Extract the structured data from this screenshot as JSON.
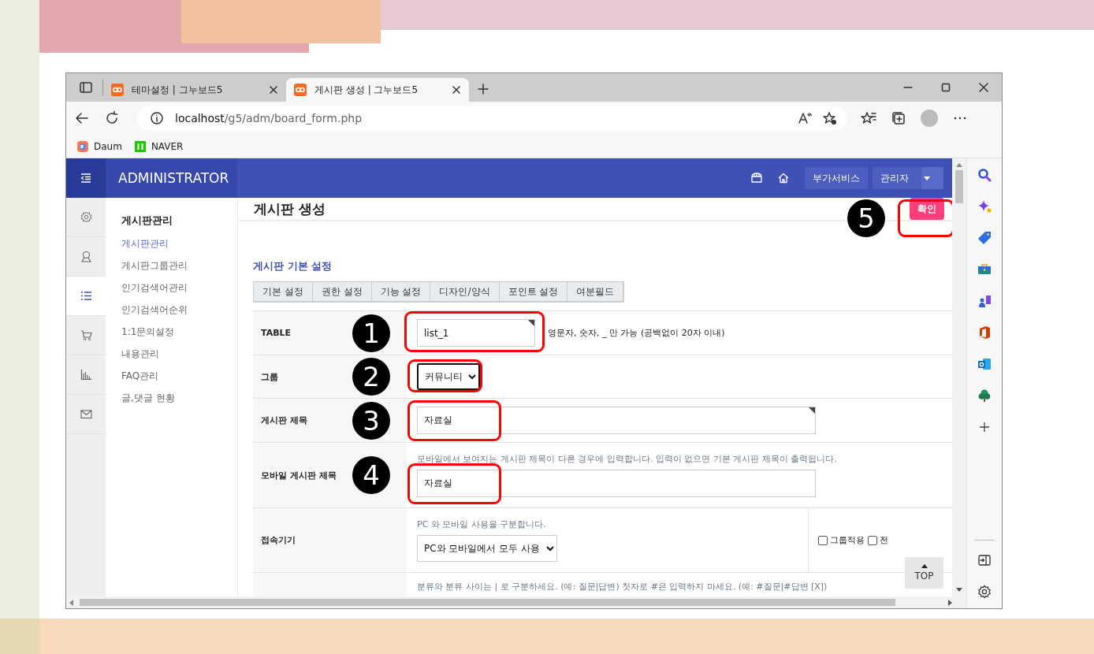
{
  "browser": {
    "tabs": [
      {
        "title": "테마설정 | 그누보드5",
        "selected": false
      },
      {
        "title": "게시판 생성 | 그누보드5",
        "selected": true
      }
    ],
    "address": {
      "host": "localhost",
      "path": "/g5/adm/board_form.php"
    },
    "bookmarks": [
      {
        "label": "Daum",
        "kind": "daum"
      },
      {
        "label": "NAVER",
        "kind": "naver"
      }
    ]
  },
  "admin": {
    "brand": "ADMINISTRATOR",
    "service_button": "부가서비스",
    "user_menu": "관리자"
  },
  "nav_icons": [
    {
      "kind": "gear",
      "selected": false
    },
    {
      "kind": "person",
      "selected": false
    },
    {
      "kind": "list",
      "selected": true
    },
    {
      "kind": "cart",
      "selected": false
    },
    {
      "kind": "chart",
      "selected": false
    },
    {
      "kind": "mail",
      "selected": false
    }
  ],
  "submenu": {
    "title": "게시판관리",
    "items": [
      {
        "label": "게시판관리",
        "selected": true
      },
      {
        "label": "게시판그룹관리",
        "selected": false
      },
      {
        "label": "인기검색어관리",
        "selected": false
      },
      {
        "label": "인기검색어순위",
        "selected": false
      },
      {
        "label": "1:1문의설정",
        "selected": false
      },
      {
        "label": "내용관리",
        "selected": false
      },
      {
        "label": "FAQ관리",
        "selected": false
      },
      {
        "label": "글,댓글 현황",
        "selected": false
      }
    ]
  },
  "page_title": "게시판 생성",
  "submit": {
    "label": "확인",
    "marker": "5"
  },
  "section_title": "게시판 기본 설정",
  "form_tabs": [
    "기본 설정",
    "권한 설정",
    "기능 설정",
    "디자인/양식",
    "포인트 설정",
    "여분필드"
  ],
  "rows": [
    {
      "label": "TABLE",
      "kind": "short",
      "value": "list_1",
      "required": true,
      "help": "영문자, 숫자, _ 만 가능 (공백없이 20자 이내)",
      "marker": "1"
    },
    {
      "label": "그룹",
      "kind": "select",
      "value": "커뮤니티",
      "marker": "2"
    },
    {
      "label": "게시판 제목",
      "kind": "wide",
      "value": "자료실",
      "required": true,
      "marker": "3"
    },
    {
      "label": "모바일 게시판 제목",
      "kind": "wide",
      "value": "자료실",
      "note": "모바일에서 보여지는 게시판 제목이 다른 경우에 입력합니다. 입력이 없으면 기본 게시판 제목이 출력됩니다.",
      "marker": "4"
    },
    {
      "label": "접속기기",
      "kind": "device",
      "note": "PC 와 모바일 사용을 구분합니다.",
      "value": "PC와 모바일에서 모두 사용",
      "options": [
        {
          "label": "그룹적용",
          "checked": false
        },
        {
          "label": "전",
          "checked": false
        }
      ]
    },
    {
      "kind": "category",
      "note": "분류와 분류 사이는 | 로 구분하세요. (예: 질문|답변) 첫자로 #은 입력하지 마세요. (예: #질문|#답변 [X])"
    }
  ],
  "top_button": "TOP"
}
